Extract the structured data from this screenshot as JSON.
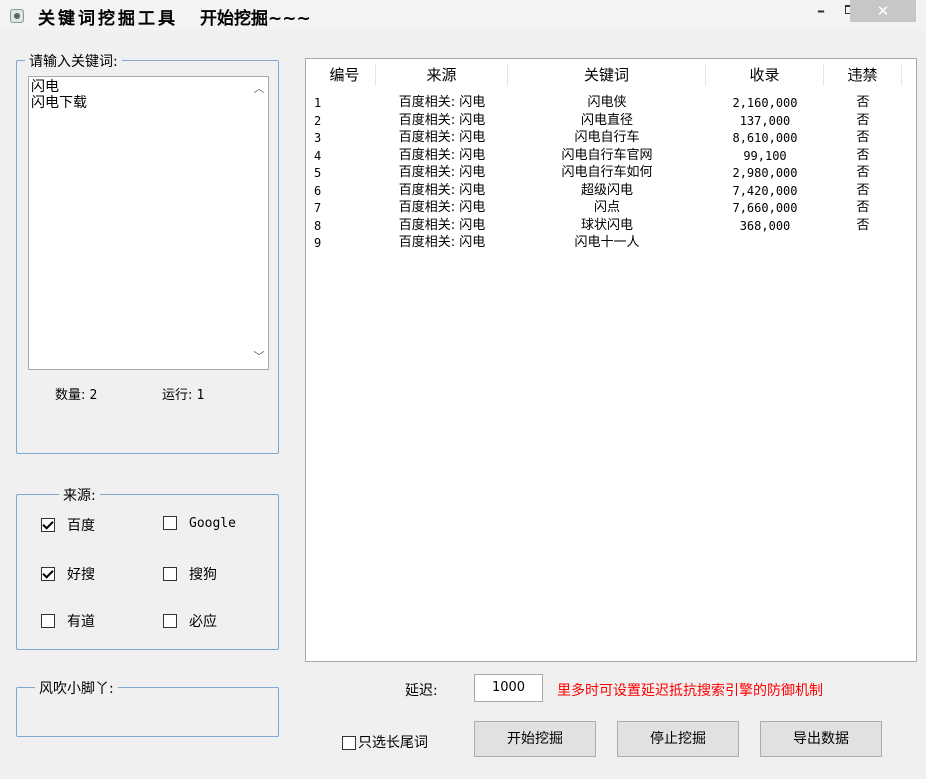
{
  "window": {
    "title": "关键词挖掘工具",
    "subtitle": "开始挖掘~~~",
    "minimize": "–",
    "close": "✕"
  },
  "keywords": {
    "legend": "请输入关键词:",
    "lines": [
      "闪电",
      "闪电下载"
    ],
    "count_label": "数量:",
    "count_value": "2",
    "run_label": "运行:",
    "run_value": "1"
  },
  "source": {
    "legend": "来源:",
    "options": [
      {
        "label": "百度",
        "checked": true
      },
      {
        "label": "Google",
        "checked": false
      },
      {
        "label": "好搜",
        "checked": true
      },
      {
        "label": "搜狗",
        "checked": false
      },
      {
        "label": "有道",
        "checked": false
      },
      {
        "label": "必应",
        "checked": false
      }
    ]
  },
  "footer_group": {
    "legend": "风吹小脚丫:"
  },
  "table": {
    "columns": [
      "编号",
      "来源",
      "关键词",
      "收录",
      "违禁"
    ],
    "rows": [
      {
        "id": "1",
        "source": "百度相关: 闪电",
        "keyword": "闪电侠",
        "count": "2,160,000",
        "banned": "否"
      },
      {
        "id": "2",
        "source": "百度相关: 闪电",
        "keyword": "闪电直径",
        "count": "137,000",
        "banned": "否"
      },
      {
        "id": "3",
        "source": "百度相关: 闪电",
        "keyword": "闪电自行车",
        "count": "8,610,000",
        "banned": "否"
      },
      {
        "id": "4",
        "source": "百度相关: 闪电",
        "keyword": "闪电自行车官网",
        "count": "99,100",
        "banned": "否"
      },
      {
        "id": "5",
        "source": "百度相关: 闪电",
        "keyword": "闪电自行车如何",
        "count": "2,980,000",
        "banned": "否"
      },
      {
        "id": "6",
        "source": "百度相关: 闪电",
        "keyword": "超级闪电",
        "count": "7,420,000",
        "banned": "否"
      },
      {
        "id": "7",
        "source": "百度相关: 闪电",
        "keyword": "闪点",
        "count": "7,660,000",
        "banned": "否"
      },
      {
        "id": "8",
        "source": "百度相关: 闪电",
        "keyword": "球状闪电",
        "count": "368,000",
        "banned": "否"
      },
      {
        "id": "9",
        "source": "百度相关: 闪电",
        "keyword": "闪电十一人",
        "count": "",
        "banned": ""
      }
    ]
  },
  "controls": {
    "delay_label": "延迟:",
    "delay_value": "1000",
    "hint": "里多时可设置延迟抵抗搜索引擎的防御机制",
    "longtail_label": "只选长尾词",
    "longtail_checked": false,
    "start_button": "开始挖掘",
    "stop_button": "停止挖掘",
    "export_button": "导出数据"
  }
}
